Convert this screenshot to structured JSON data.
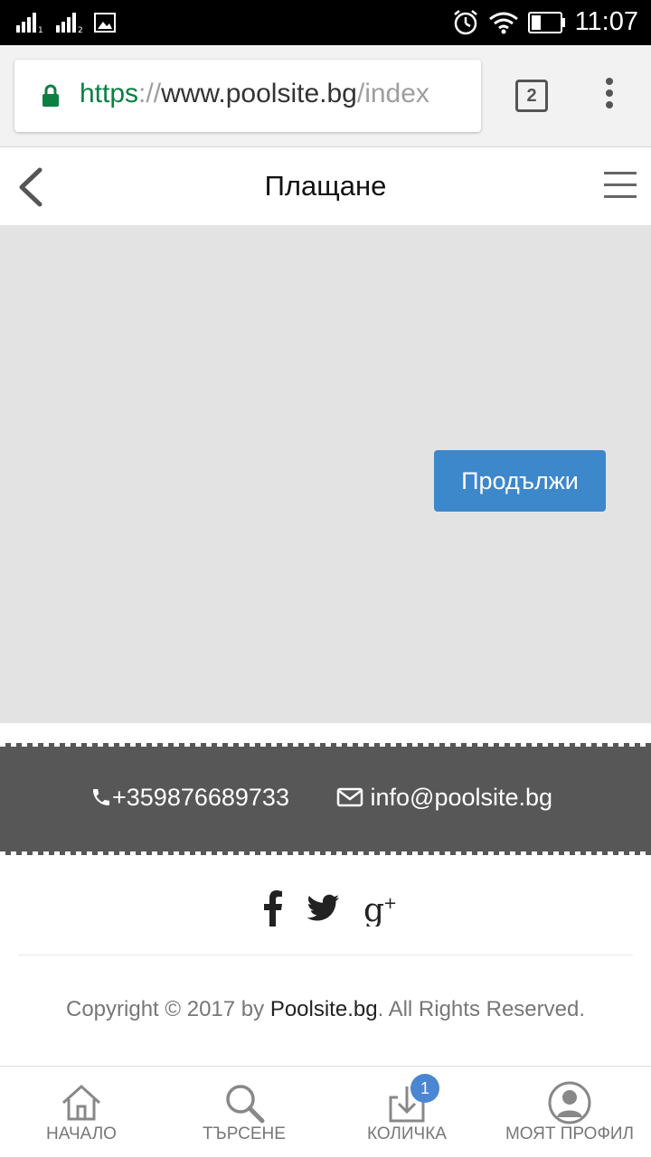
{
  "status_bar": {
    "time": "11:07"
  },
  "browser": {
    "url_scheme": "https",
    "url_sep": "://",
    "url_host": "www.poolsite.bg",
    "url_path": "/index",
    "tab_count": "2"
  },
  "header": {
    "title": "Плащане"
  },
  "content": {
    "continue_label": "Продължи"
  },
  "contact": {
    "phone": "+359876689733",
    "email": "info@poolsite.bg"
  },
  "footer": {
    "copyright_prefix": "Copyright © 2017 by ",
    "copyright_brand": "Poolsite.bg",
    "copyright_suffix": ". All Rights Reserved."
  },
  "bottom_nav": {
    "items": [
      {
        "label": "НАЧАЛО",
        "icon": "home-icon"
      },
      {
        "label": "ТЪРСЕНЕ",
        "icon": "search-icon"
      },
      {
        "label": "КОЛИЧКА",
        "icon": "cart-icon",
        "badge": "1"
      },
      {
        "label": "МОЯТ ПРОФИЛ",
        "icon": "profile-icon"
      }
    ]
  },
  "colors": {
    "accent": "#3d87cb",
    "contact_bg": "#575757",
    "content_bg": "#e3e3e3",
    "badge": "#4a86d2",
    "secure_green": "#0b8043"
  }
}
